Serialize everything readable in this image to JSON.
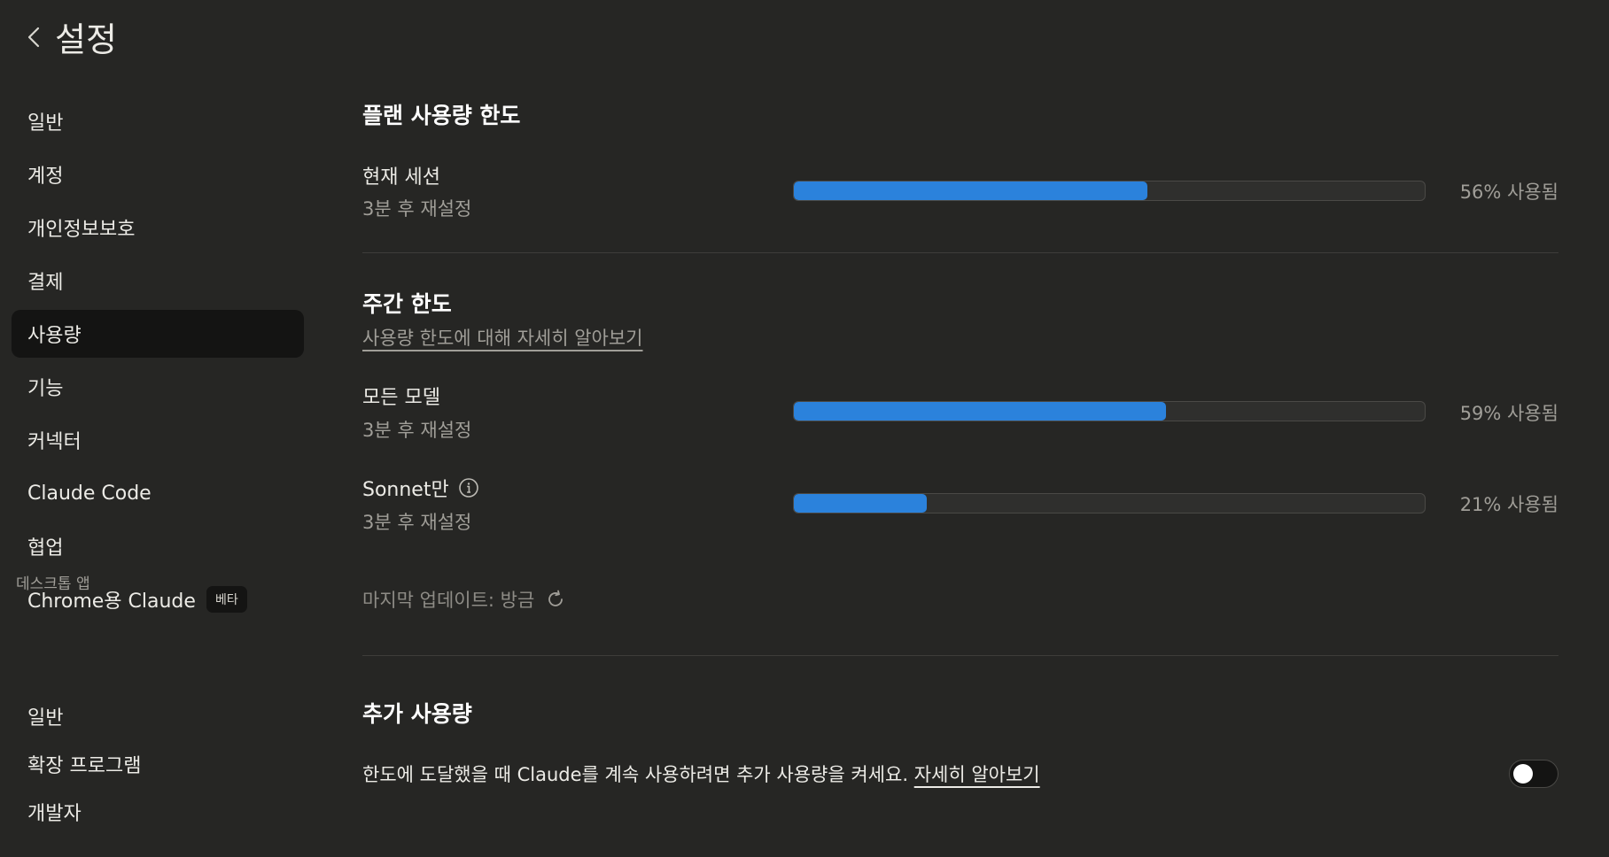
{
  "header": {
    "title": "설정"
  },
  "sidebar": {
    "items": [
      {
        "label": "일반"
      },
      {
        "label": "계정"
      },
      {
        "label": "개인정보보호"
      },
      {
        "label": "결제"
      },
      {
        "label": "사용량"
      },
      {
        "label": "기능"
      },
      {
        "label": "커넥터"
      },
      {
        "label": "Claude Code"
      },
      {
        "label": "협업"
      },
      {
        "label": "Chrome용 Claude",
        "badge": "베타"
      }
    ],
    "active": "사용량",
    "section_label": "데스크톱 앱",
    "desktop_items": [
      {
        "label": "일반"
      },
      {
        "label": "확장 프로그램"
      },
      {
        "label": "개발자"
      }
    ]
  },
  "plan": {
    "title": "플랜 사용량 한도",
    "session": {
      "label": "현재 세션",
      "reset": "3분 후 재설정",
      "percent": 56,
      "percent_text": "56% 사용됨"
    }
  },
  "weekly": {
    "title": "주간 한도",
    "learn_more": "사용량 한도에 대해 자세히 알아보기",
    "all_models": {
      "label": "모든 모델",
      "reset": "3분 후 재설정",
      "percent": 59,
      "percent_text": "59% 사용됨"
    },
    "sonnet": {
      "label": "Sonnet만",
      "reset": "3분 후 재설정",
      "percent": 21,
      "percent_text": "21% 사용됨"
    },
    "last_updated": "마지막 업데이트: 방금"
  },
  "extra": {
    "title": "추가 사용량",
    "description": "한도에 도달했을 때 Claude를 계속 사용하려면 추가 사용량을 켜세요.",
    "link": "자세히 알아보기",
    "toggle_on": false
  },
  "colors": {
    "background": "#262624",
    "bar_fill": "#2b82dc",
    "active_nav": "#141413"
  },
  "icons": {
    "back": "chevron-left-icon",
    "info": "info-icon",
    "refresh": "refresh-icon"
  }
}
